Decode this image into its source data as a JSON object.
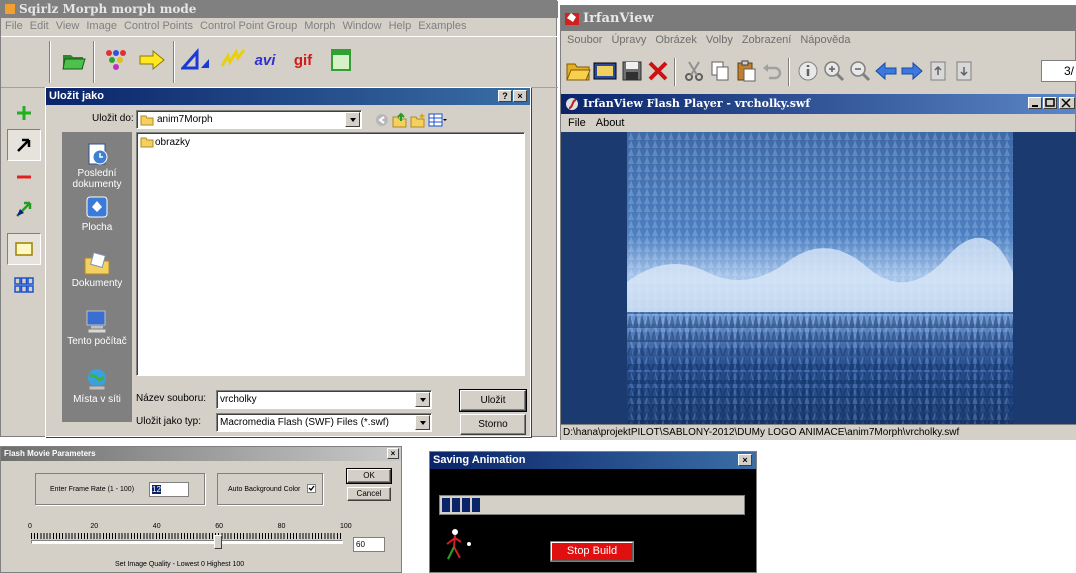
{
  "sqirlz": {
    "title": "Sqirlz Morph   morph mode",
    "menu": [
      "File",
      "Edit",
      "View",
      "Image",
      "Control Points",
      "Control Point Group",
      "Morph",
      "Window",
      "Help",
      "Examples"
    ],
    "toolbar": {
      "avi_label": "avi",
      "gif_label": "gif"
    }
  },
  "save_dialog": {
    "title": "Uložit jako",
    "help_btn": "?",
    "close_btn": "×",
    "save_in_label": "Uložit do:",
    "save_in_value": "anim7Morph",
    "places": [
      "Poslední dokumenty",
      "Plocha",
      "Dokumenty",
      "Tento počítač",
      "Místa v síti"
    ],
    "files": [
      "obrazky"
    ],
    "filename_label": "Název souboru:",
    "filename_value": "vrcholky",
    "filetype_label": "Uložit jako typ:",
    "filetype_value": "Macromedia Flash (SWF) Files (*.swf)",
    "save_btn": "Uložit",
    "cancel_btn": "Storno"
  },
  "irfanview": {
    "title": "IrfanView",
    "menu": [
      "Soubor",
      "Úpravy",
      "Obrázek",
      "Volby",
      "Zobrazení",
      "Nápověda"
    ],
    "page_counter": "3/",
    "flash_player": {
      "title": "IrfanView Flash Player - vrcholky.swf",
      "menu": [
        "File",
        "About"
      ],
      "status": "D:\\hana\\projektPILOT\\SABLONY-2012\\DUMy LOGO ANIMACE\\anim7Morph\\vrcholky.swf"
    }
  },
  "flash_params": {
    "title": "Flash Movie Parameters",
    "close_btn": "×",
    "frame_rate_label": "Enter Frame Rate (1 - 100)",
    "frame_rate_value": "12",
    "auto_bg_label": "Auto Background Color",
    "auto_bg_checked": true,
    "ok_btn": "OK",
    "cancel_btn": "Cancel",
    "scale": [
      "0",
      "20",
      "40",
      "60",
      "80",
      "100"
    ],
    "quality_value": "60",
    "quality_fraction": 0.6,
    "quality_caption": "Set Image Quality  -  Lowest 0  Highest 100"
  },
  "saving": {
    "title": "Saving Animation",
    "close_btn": "×",
    "progress_blocks": 4,
    "stop_btn": "Stop Build"
  }
}
